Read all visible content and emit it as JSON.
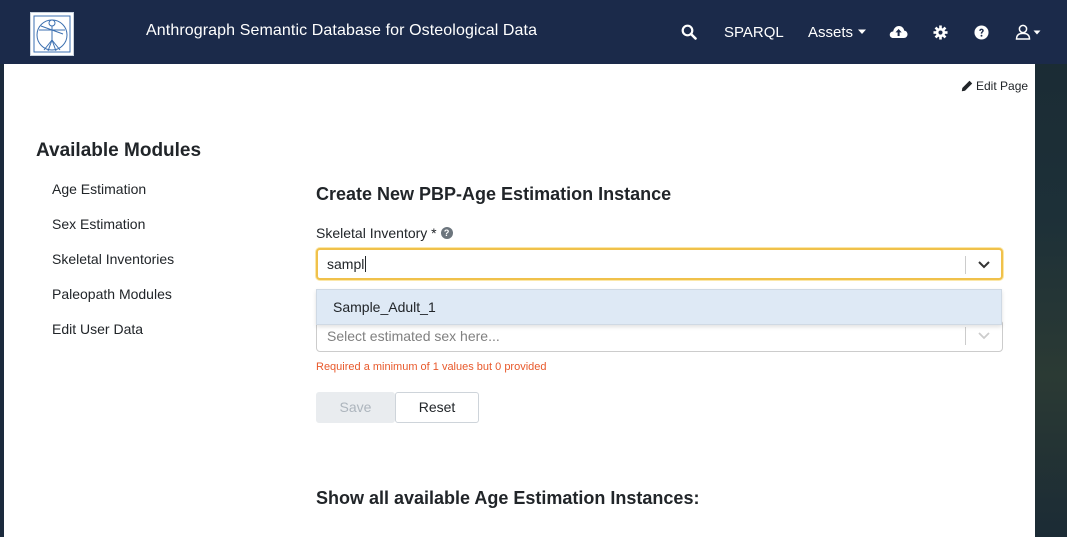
{
  "navbar": {
    "brand": "Anthrograph Semantic Database for Osteological Data",
    "sparql": "SPARQL",
    "assets": "Assets",
    "icons": [
      "search-icon",
      "cloud-upload-icon",
      "gear-icon",
      "question-circle-icon",
      "user-icon"
    ]
  },
  "edit_page": "Edit Page",
  "sidebar": {
    "title": "Available Modules",
    "items": [
      {
        "label": "Age Estimation"
      },
      {
        "label": "Sex Estimation"
      },
      {
        "label": "Skeletal Inventories"
      },
      {
        "label": "Paleopath Modules"
      },
      {
        "label": "Edit User Data"
      }
    ]
  },
  "form": {
    "title": "Create New PBP-Age Estimation Instance",
    "inventory_label": "Skeletal Inventory *",
    "inventory_value": "sampl",
    "dropdown_option": "Sample_Adult_1",
    "sex_placeholder": "Select estimated sex here...",
    "error": "Required a minimum of 1 values but 0 provided",
    "save": "Save",
    "reset": "Reset"
  },
  "show_all": "Show all available Age Estimation Instances:",
  "colors": {
    "navbar": "#1b2a4a",
    "focus_border": "#f0c14b",
    "dropdown_highlight": "#dee9f5",
    "error": "#e8592b"
  }
}
